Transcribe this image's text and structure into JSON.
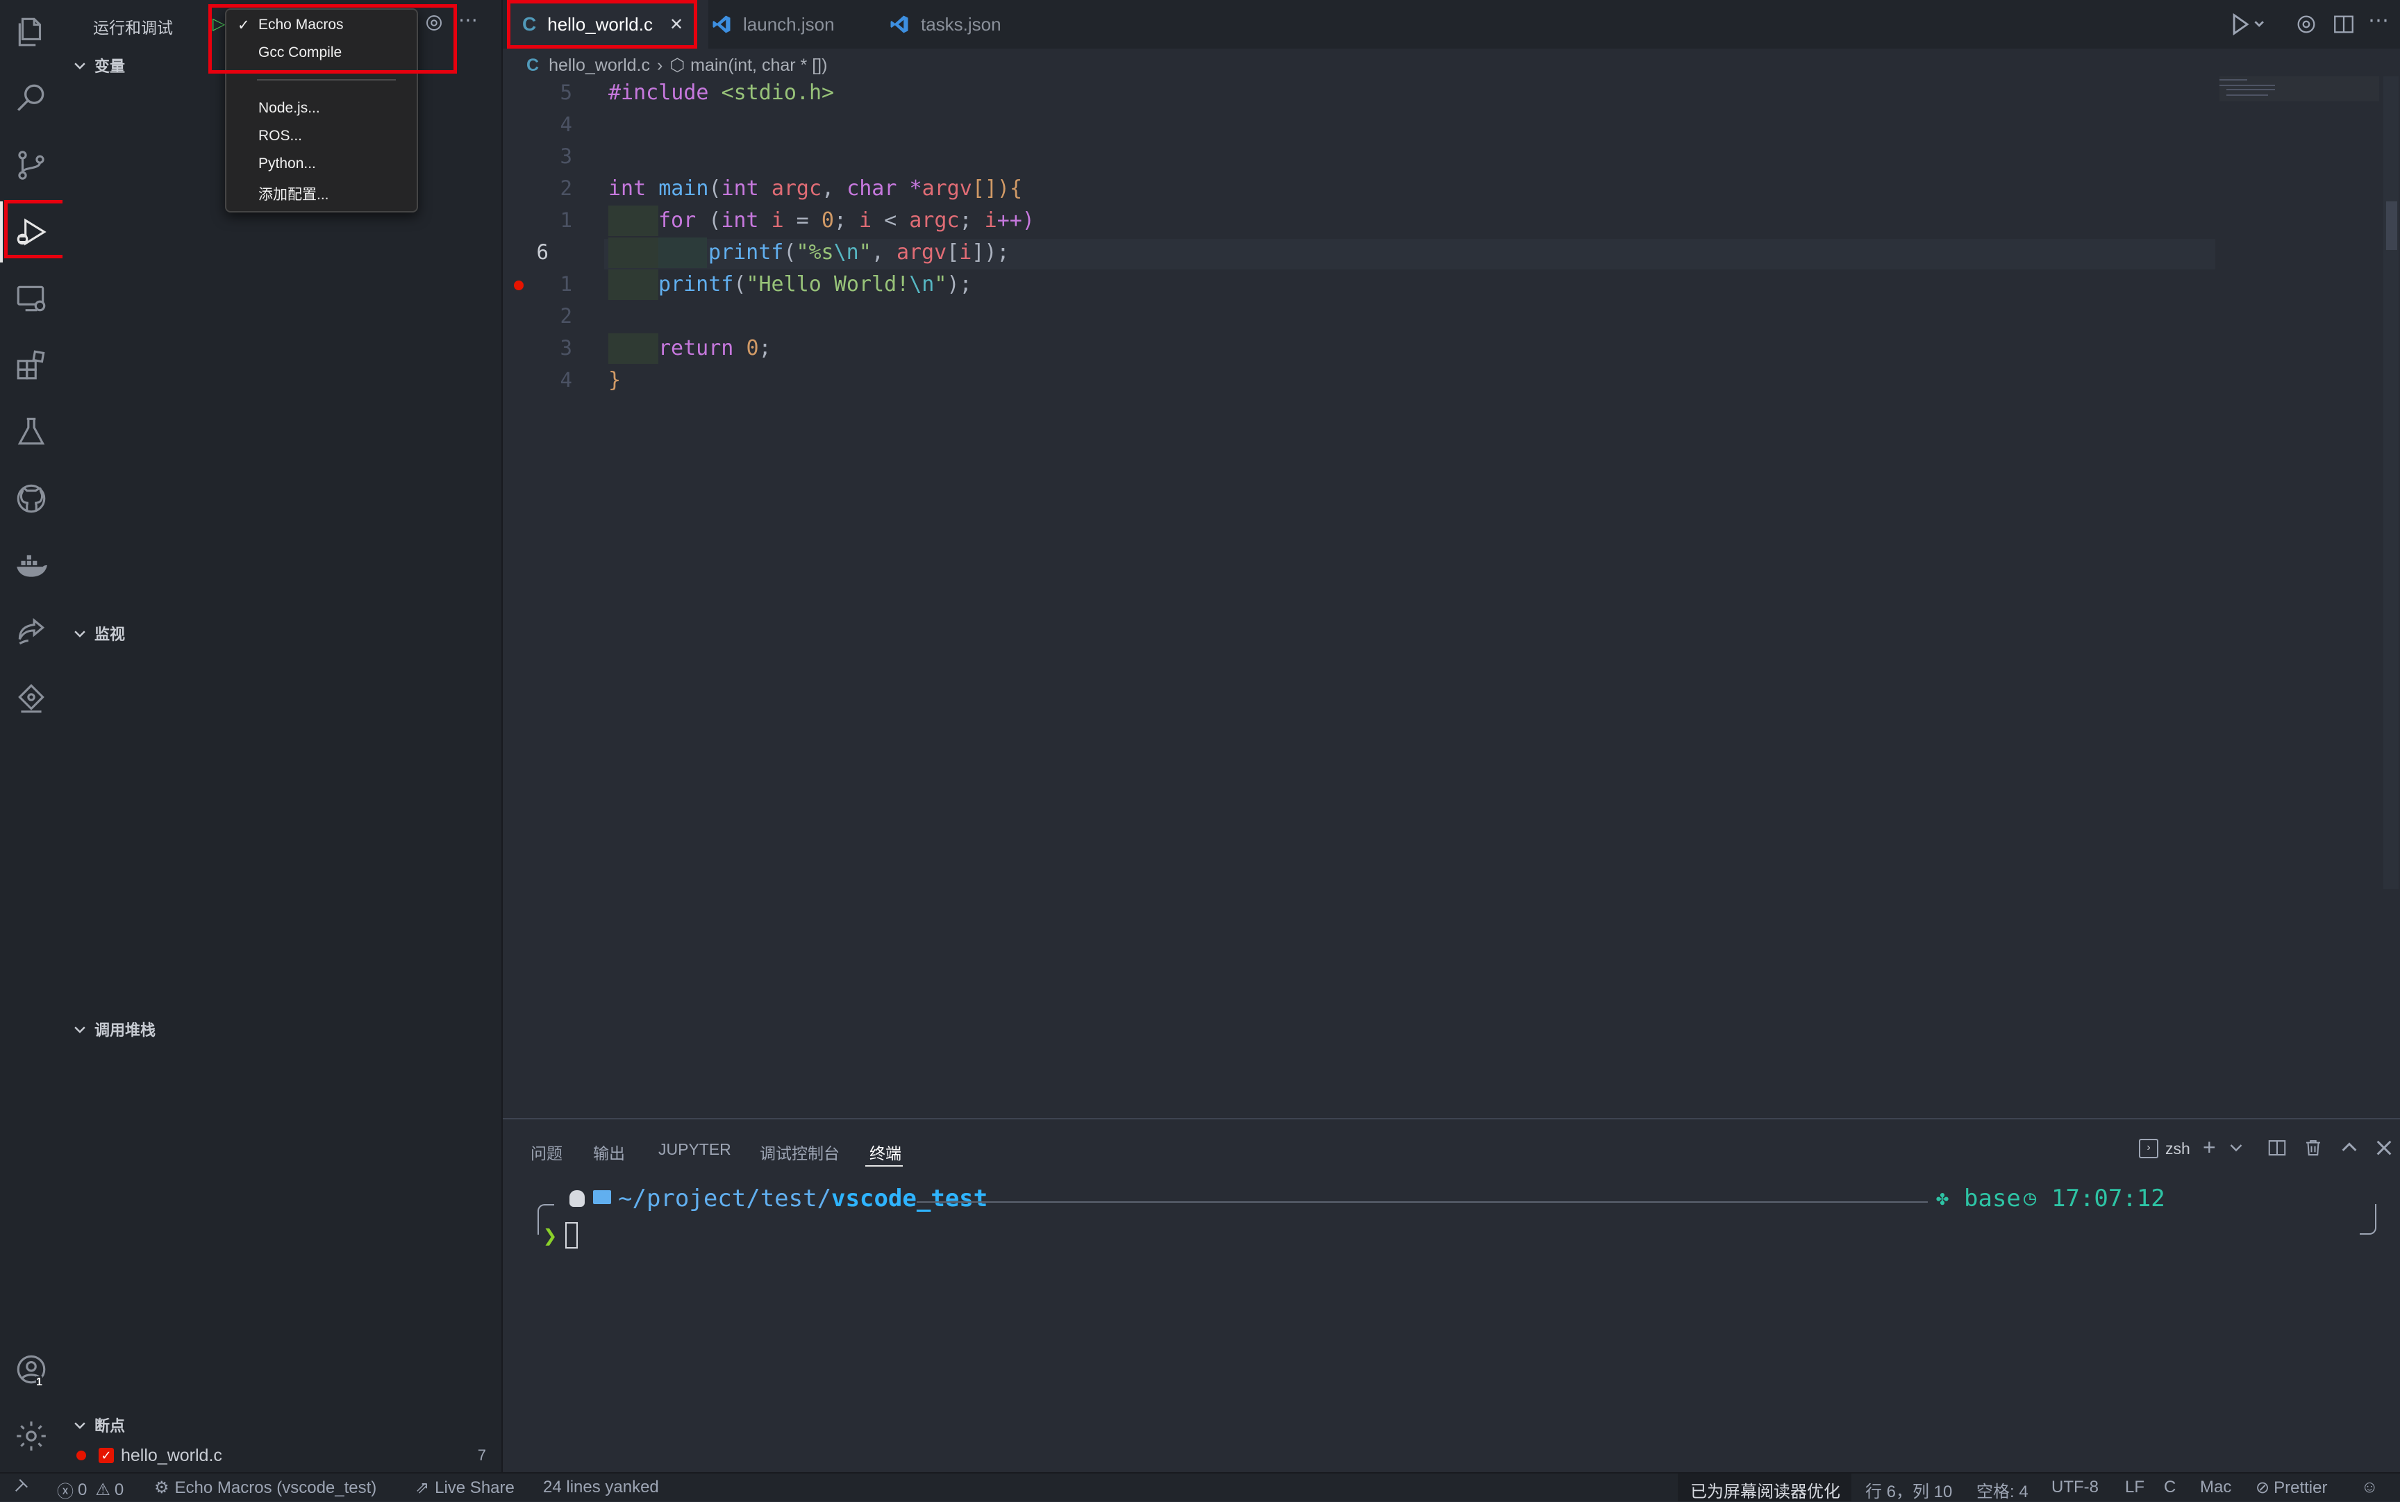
{
  "sidebar": {
    "title": "运行和调试",
    "sections": {
      "variables": "变量",
      "watch": "监视",
      "call_stack": "调用堆栈",
      "breakpoints": "断点"
    },
    "breakpoint_item": {
      "file": "hello_world.c",
      "count": "7"
    }
  },
  "debug_config_menu": {
    "checkmark": "✓",
    "items": [
      "Echo Macros",
      "Gcc Compile",
      "Node.js...",
      "ROS...",
      "Python...",
      "添加配置..."
    ],
    "selected": "Echo Macros"
  },
  "tabs": [
    {
      "label": "hello_world.c",
      "icon": "C",
      "active": true
    },
    {
      "label": "launch.json",
      "icon": "vscode-icon",
      "active": false
    },
    {
      "label": "tasks.json",
      "icon": "vscode-icon",
      "active": false
    }
  ],
  "tab_close": "✕",
  "breadcrumb": {
    "file": "hello_world.c",
    "symbol": "main(int, char * [])"
  },
  "code": {
    "line_numbers": [
      "5",
      "4",
      "3",
      "2",
      "1",
      "6",
      "1",
      "2",
      "3",
      "4"
    ],
    "lines": {
      "l1": {
        "a": "#include ",
        "b": "<stdio.h>"
      },
      "l4": {
        "a": "int ",
        "b": "main",
        "c": "(",
        "d": "int ",
        "e": "argc",
        "f": ", ",
        "g": "char ",
        "h": "*",
        "i": "argv",
        "j": "[]){"
      },
      "l5": {
        "a": "for ",
        "b": "(",
        "c": "int ",
        "d": "i",
        "e": " = ",
        "f": "0",
        "g": "; ",
        "h": "i",
        "i": " < ",
        "j": "argc",
        "k": "; ",
        "l": "i",
        "m": "++)"
      },
      "l6": {
        "a": "printf",
        "b": "(",
        "c": "\"%s",
        "d": "\\n",
        "e": "\"",
        "f": ", ",
        "g": "argv",
        "h": "[",
        "i": "i",
        "j": "]);"
      },
      "l7": {
        "a": "printf",
        "b": "(",
        "c": "\"Hello World!",
        "d": "\\n",
        "e": "\"",
        "f": ");"
      },
      "l9": {
        "a": "return ",
        "b": "0",
        "c": ";"
      },
      "l10": {
        "a": "}"
      }
    }
  },
  "panel": {
    "tabs": [
      "问题",
      "输出",
      "JUPYTER",
      "调试控制台",
      "终端"
    ],
    "active_tab": "终端",
    "shell": "zsh",
    "terminal": {
      "path_prefix": "~/project/test/",
      "path_dir": "vscode_test",
      "env": "base",
      "time": "17:07:12",
      "prompt": "❯"
    }
  },
  "status": {
    "errors": "0",
    "warnings": "0",
    "debug_config": "Echo Macros (vscode_test)",
    "live_share": "Live Share",
    "message": "24 lines yanked",
    "screen_reader": "已为屏幕阅读器优化",
    "position": "行 6，列 10",
    "spaces": "空格: 4",
    "encoding": "UTF-8",
    "eol": "LF",
    "language": "C",
    "platform": "Mac",
    "formatter": "Prettier"
  },
  "accounts_badge": "1",
  "colors": {
    "highlight_box": "#e8000e",
    "c_file": "#519aba",
    "vscode_blue": "#3d8fe0",
    "breakpoint": "#e51400",
    "terminal_path": "#61afef",
    "terminal_green": "#2ec4a5",
    "prompt": "#8bd12a"
  }
}
